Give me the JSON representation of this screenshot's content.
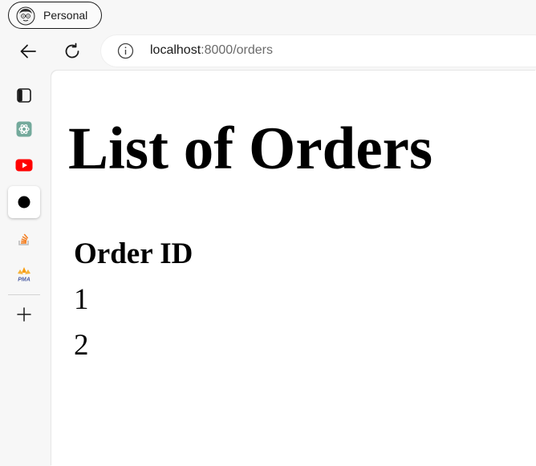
{
  "profile": {
    "label": "Personal",
    "avatar_icon": "cartoon-avatar"
  },
  "nav": {
    "back_icon": "arrow-left-icon",
    "reload_icon": "reload-icon"
  },
  "address_bar": {
    "info_icon": "info-icon",
    "host": "localhost",
    "rest": ":8000/orders"
  },
  "sidebar": {
    "items": [
      {
        "name": "sidebar-toggle",
        "icon": "sidebar-panel-icon"
      },
      {
        "name": "chatgpt",
        "icon": "chatgpt-icon",
        "color": "#74aa9c"
      },
      {
        "name": "youtube",
        "icon": "youtube-icon",
        "color": "#ff0000"
      },
      {
        "name": "active-app",
        "icon": "black-dot-icon"
      },
      {
        "name": "stack-overflow",
        "icon": "stack-overflow-icon",
        "color": "#f48024"
      },
      {
        "name": "phpmyadmin",
        "icon": "phpmyadmin-icon",
        "color": "#f89c0e"
      },
      {
        "name": "add",
        "icon": "plus-icon"
      }
    ]
  },
  "page": {
    "title": "List of Orders",
    "table": {
      "header": "Order ID",
      "rows": [
        "1",
        "2"
      ]
    }
  }
}
